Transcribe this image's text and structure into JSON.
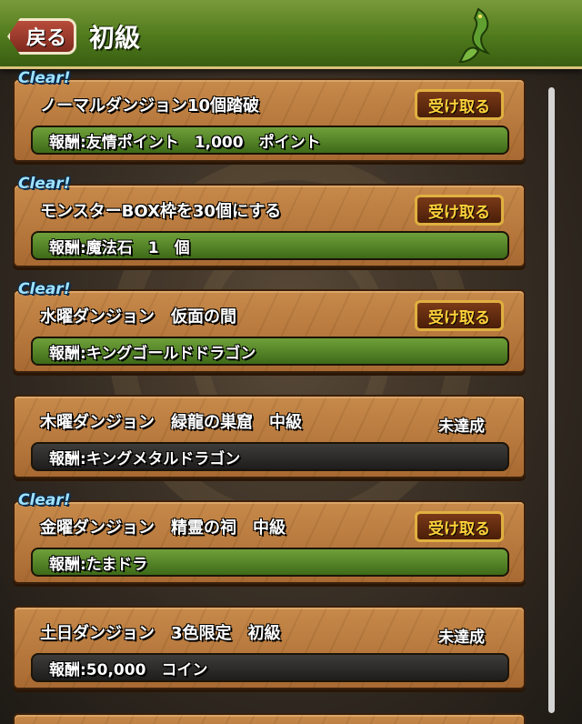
{
  "header": {
    "back_label": "戻る",
    "title": "初級"
  },
  "clear_label": "Clear!",
  "receive_label": "受け取る",
  "missions": [
    {
      "title": "ノーマルダンジョン10個踏破",
      "reward": "報酬:友情ポイント　1,000　ポイント",
      "cleared": true,
      "status": ""
    },
    {
      "title": "モンスターBOX枠を30個にする",
      "reward": "報酬:魔法石　1　個",
      "cleared": true,
      "status": ""
    },
    {
      "title": "水曜ダンジョン　仮面の間",
      "reward": "報酬:キングゴールドドラゴン",
      "cleared": true,
      "status": ""
    },
    {
      "title": "木曜ダンジョン　緑龍の巣窟　中級",
      "reward": "報酬:キングメタルドラゴン",
      "cleared": false,
      "status": "未達成"
    },
    {
      "title": "金曜ダンジョン　精霊の祠　中級",
      "reward": "報酬:たまドラ",
      "cleared": true,
      "status": ""
    },
    {
      "title": "土日ダンジョン　3色限定　初級",
      "reward": "報酬:50,000　コイン",
      "cleared": false,
      "status": "未達成"
    }
  ],
  "colors": {
    "header_green": "#4f7a1c",
    "card_brown": "#b87a3e",
    "reward_achieved": "#4f8222",
    "reward_pending": "#2a2928",
    "clear_blue": "#9fe2ff",
    "button_gold": "#ffd23a"
  }
}
